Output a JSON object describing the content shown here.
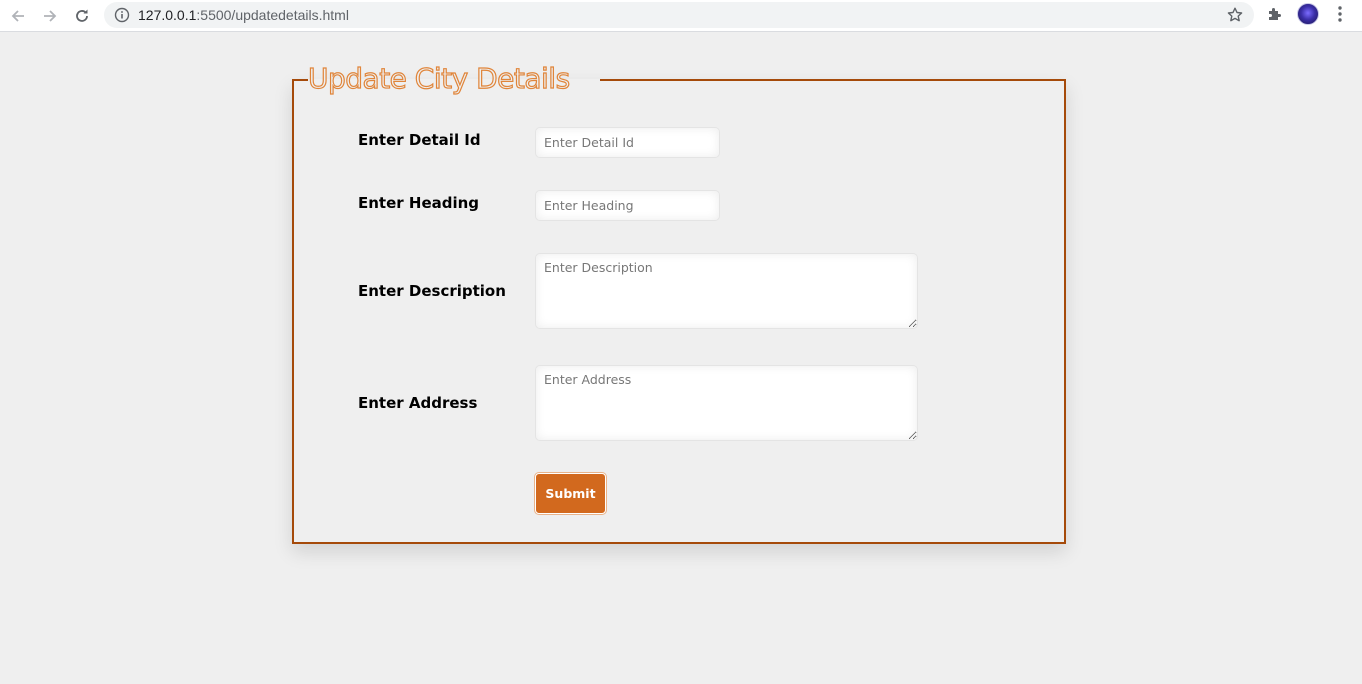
{
  "browser": {
    "url_host": "127.0.0.1",
    "url_path": ":5500/updatedetails.html"
  },
  "form": {
    "legend": "Update City Details",
    "fields": [
      {
        "label": "Enter Detail Id",
        "placeholder": "Enter Detail Id"
      },
      {
        "label": "Enter Heading",
        "placeholder": "Enter Heading"
      },
      {
        "label": "Enter Description",
        "placeholder": "Enter Description"
      },
      {
        "label": "Enter Address",
        "placeholder": "Enter Address"
      }
    ],
    "submit_label": "Submit"
  },
  "colors": {
    "border": "#a54a0a",
    "legend_outline": "#e0853a",
    "button": "#d2691e",
    "background": "#efefef"
  }
}
